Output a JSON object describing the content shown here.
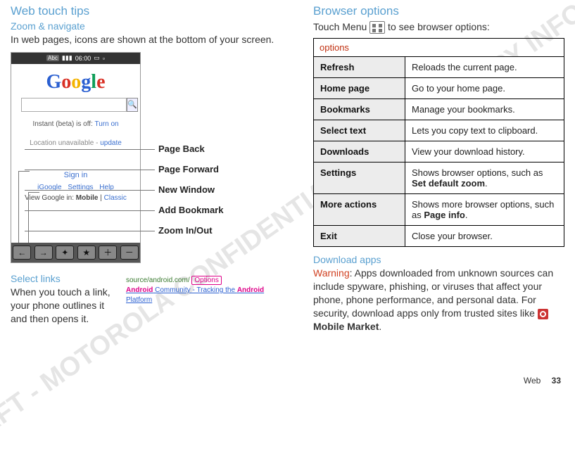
{
  "watermark": "DRAFT - MOTOROLA CONFIDENTIAL\n& PROPRIETARY INFORMATION",
  "left": {
    "title": "Web touch tips",
    "zoom_nav_heading": "Zoom & navigate",
    "zoom_nav_body": "In web pages, icons are shown at the bottom of your screen.",
    "phone": {
      "status_abc": "Abc",
      "status_time": "06:00",
      "logo_chars": [
        "G",
        "o",
        "o",
        "g",
        "l",
        "e"
      ],
      "search_placeholder": "",
      "search_btn_glyph": "🔍",
      "instant_prefix": "Instant (beta) is off:",
      "instant_action": "Turn on",
      "location_prefix": "Location unavailable -",
      "location_action": "update",
      "signin": "Sign in",
      "mini_links": "iGoogle    Settings    Help",
      "view_prefix": "View Google in:",
      "view_mobile": "Mobile",
      "view_sep": " | ",
      "view_classic": "Classic",
      "tb_back": "←",
      "tb_fwd": "→",
      "tb_new": "✦",
      "tb_book": "★",
      "tb_zin": "＋",
      "tb_zout": "－"
    },
    "callouts": {
      "back": "Page Back",
      "fwd": "Page Forward",
      "newwin": "New Window",
      "addbm": "Add Bookmark",
      "zoom": "Zoom In/Out"
    },
    "select_heading": "Select links",
    "select_body": "When you touch a link, your phone outlines it and then opens it.",
    "snippet": {
      "url": "source/android.com/",
      "options": "Options",
      "bold1": "Android",
      "mid": " Community - Tracking the ",
      "bold2": "Android",
      "tail": " Platform"
    }
  },
  "right": {
    "title": "Browser options",
    "intro_prefix": "Touch Menu ",
    "intro_suffix": " to see browser options:",
    "table_caption": "options",
    "rows": [
      {
        "k": "Refresh",
        "v": "Reloads the current page."
      },
      {
        "k": "Home page",
        "v": "Go to your home page."
      },
      {
        "k": "Bookmarks",
        "v": "Manage your bookmarks."
      },
      {
        "k": "Select text",
        "v": "Lets you copy text to clipboard."
      },
      {
        "k": "Downloads",
        "v": "View your download history."
      },
      {
        "k": "Settings",
        "v_pre": "Shows browser options, such as ",
        "v_bold": "Set default zoom",
        "v_post": "."
      },
      {
        "k": "More actions",
        "v_pre": "Shows more browser options, such as ",
        "v_bold": "Page info",
        "v_post": "."
      },
      {
        "k": "Exit",
        "v": "Close your browser."
      }
    ],
    "dl_heading": "Download apps",
    "dl_warning_label": "Warning",
    "dl_body_pre": ": Apps downloaded from unknown sources can include spyware, phishing, or viruses that affect your phone, phone performance, and personal data. For security, download apps only from trusted sites like ",
    "dl_body_bold": "Mobile Market",
    "dl_body_post": "."
  },
  "footer": {
    "section": "Web",
    "page": "33"
  }
}
